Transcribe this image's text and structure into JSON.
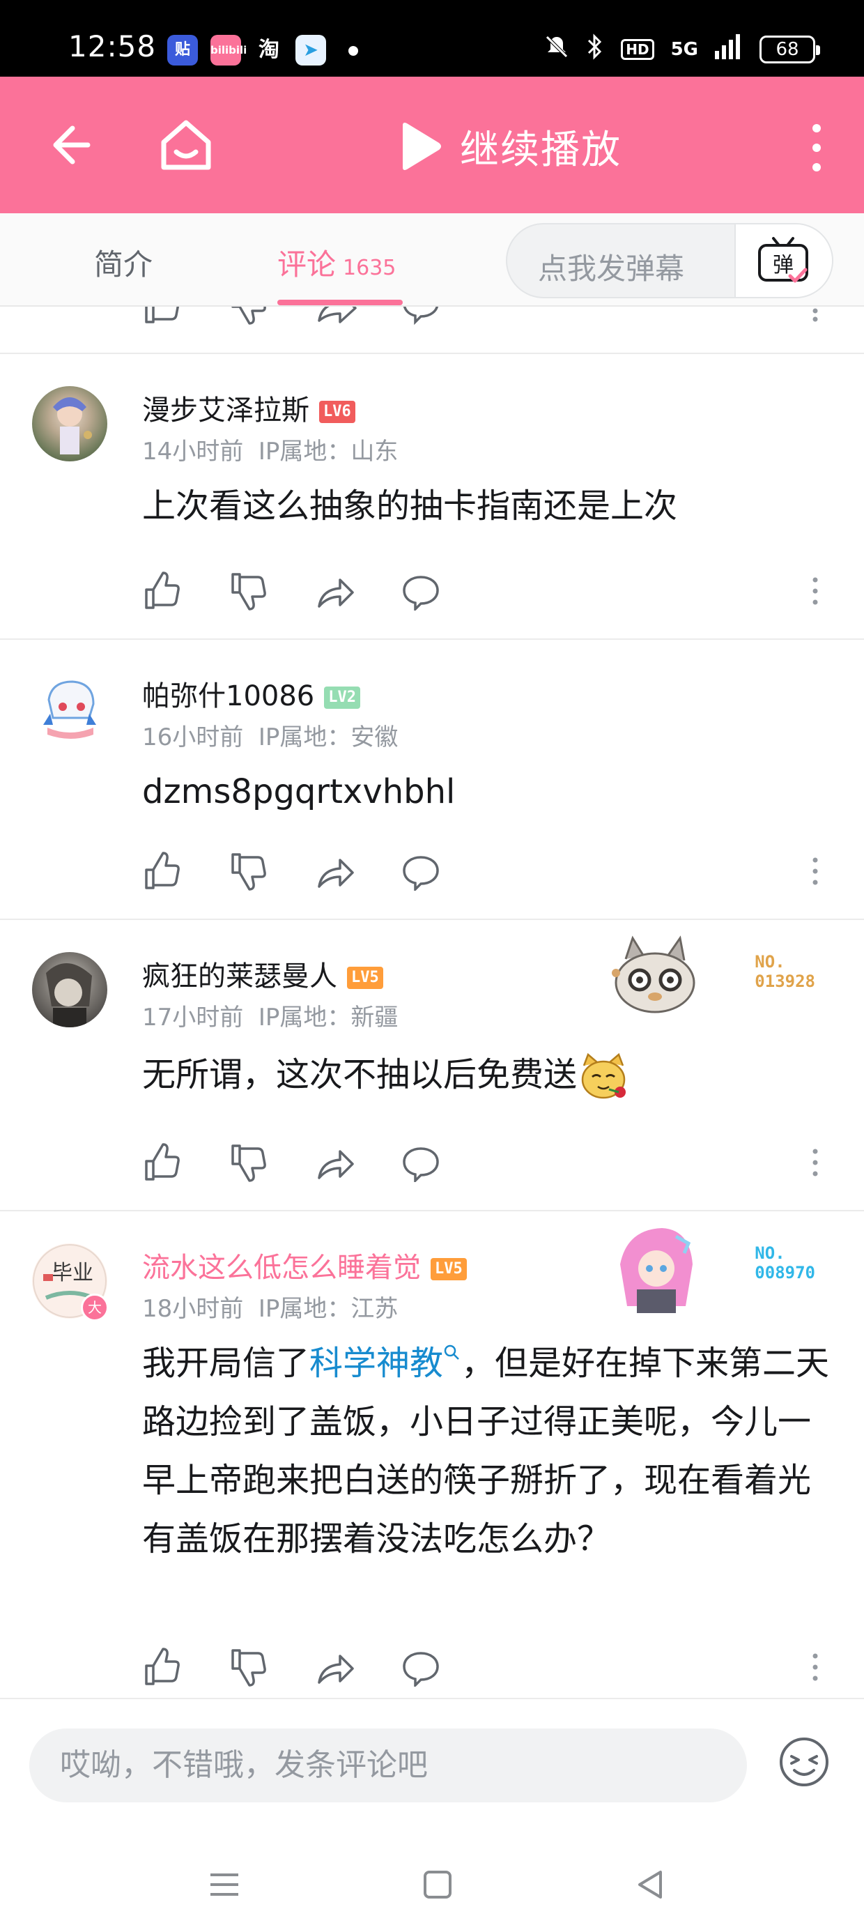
{
  "status_bar": {
    "time": "12:58",
    "apps": [
      "贴",
      "bilibili",
      "淘"
    ],
    "network": "5G",
    "battery": "68",
    "hd": "HD"
  },
  "header": {
    "title": "继续播放",
    "accent_color": "#fb7299"
  },
  "tabs": {
    "intro_label": "简介",
    "comments_label": "评论",
    "comments_count": "1635",
    "danmaku_placeholder": "点我发弹幕",
    "danmaku_icon_text": "弹"
  },
  "comments": [
    {
      "username": "漫步艾泽拉斯",
      "level": "LV6",
      "time": "14小时前",
      "ip": "IP属地：山东",
      "content": "上次看这么抽象的抽卡指南还是上次"
    },
    {
      "username": "帕弥什10086",
      "level": "LV2",
      "time": "16小时前",
      "ip": "IP属地：安徽",
      "content": "dzms8pgqrtxvhbhl"
    },
    {
      "username": "疯狂的莱瑟曼人",
      "level": "LV5",
      "time": "17小时前",
      "ip": "IP属地：新疆",
      "content": "无所谓，这次不抽以后免费送",
      "fan_no_label": "NO.",
      "fan_no": "013928"
    },
    {
      "username": "流水这么低怎么睡着觉",
      "level": "LV5",
      "time": "18小时前",
      "ip": "IP属地：江苏",
      "content_before": "我开局信了",
      "content_link": "科学神教",
      "content_after": "，但是好在掉下来第二天路边捡到了盖饭，小日子过得正美呢，今儿一早上帝跑来把白送的筷子掰折了，现在看着光有盖饭在那摆着没法吃怎么办？",
      "fan_no_label": "NO.",
      "fan_no": "008970",
      "avatar_text": "毕业",
      "avatar_badge": "大"
    }
  ],
  "bottom": {
    "input_placeholder": "哎呦，不错哦，发条评论吧"
  }
}
